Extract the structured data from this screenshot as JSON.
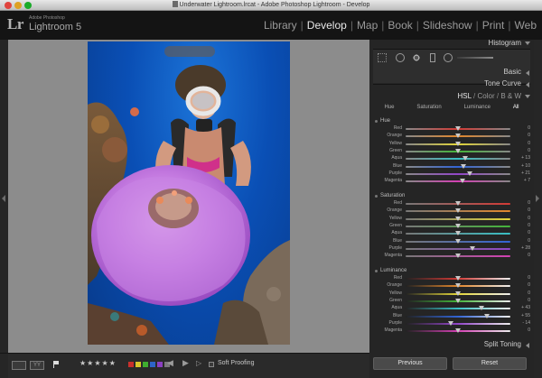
{
  "window": {
    "title": "Underwater Lightroom.lrcat - Adobe Photoshop Lightroom - Develop"
  },
  "identity": {
    "logo": "Lr",
    "brand": "Adobe Photoshop",
    "product": "Lightroom 5"
  },
  "modules": [
    {
      "label": "Library",
      "active": false
    },
    {
      "label": "Develop",
      "active": true
    },
    {
      "label": "Map",
      "active": false
    },
    {
      "label": "Book",
      "active": false
    },
    {
      "label": "Slideshow",
      "active": false
    },
    {
      "label": "Print",
      "active": false
    },
    {
      "label": "Web",
      "active": false
    }
  ],
  "panels": {
    "histogram": "Histogram",
    "basic": "Basic",
    "tone_curve": "Tone Curve",
    "hsl_title": "HSL",
    "hsl_sep1": "/",
    "color_title": "Color",
    "hsl_sep2": "/",
    "bw_title": "B & W",
    "split_toning": "Split Toning"
  },
  "hsl_tabs": [
    {
      "label": "Hue",
      "active": false
    },
    {
      "label": "Saturation",
      "active": false
    },
    {
      "label": "Luminance",
      "active": false
    },
    {
      "label": "All",
      "active": true
    }
  ],
  "sections": [
    {
      "title": "Hue",
      "sliders": [
        {
          "label": "Red",
          "value": "0",
          "pos": 0.5
        },
        {
          "label": "Orange",
          "value": "0",
          "pos": 0.5
        },
        {
          "label": "Yellow",
          "value": "0",
          "pos": 0.5
        },
        {
          "label": "Green",
          "value": "0",
          "pos": 0.5
        },
        {
          "label": "Aqua",
          "value": "+ 13",
          "pos": 0.57
        },
        {
          "label": "Blue",
          "value": "+ 10",
          "pos": 0.55
        },
        {
          "label": "Purple",
          "value": "+ 21",
          "pos": 0.61
        },
        {
          "label": "Magenta",
          "value": "+ 7",
          "pos": 0.54
        }
      ]
    },
    {
      "title": "Saturation",
      "sliders": [
        {
          "label": "Red",
          "value": "0",
          "pos": 0.5
        },
        {
          "label": "Orange",
          "value": "0",
          "pos": 0.5
        },
        {
          "label": "Yellow",
          "value": "0",
          "pos": 0.5
        },
        {
          "label": "Green",
          "value": "0",
          "pos": 0.5
        },
        {
          "label": "Aqua",
          "value": "0",
          "pos": 0.5
        },
        {
          "label": "Blue",
          "value": "0",
          "pos": 0.5
        },
        {
          "label": "Purple",
          "value": "+ 28",
          "pos": 0.64
        },
        {
          "label": "Magenta",
          "value": "0",
          "pos": 0.5
        }
      ]
    },
    {
      "title": "Luminance",
      "sliders": [
        {
          "label": "Red",
          "value": "0",
          "pos": 0.5
        },
        {
          "label": "Orange",
          "value": "0",
          "pos": 0.5
        },
        {
          "label": "Yellow",
          "value": "0",
          "pos": 0.5
        },
        {
          "label": "Green",
          "value": "0",
          "pos": 0.5
        },
        {
          "label": "Aqua",
          "value": "+ 43",
          "pos": 0.72
        },
        {
          "label": "Blue",
          "value": "+ 55",
          "pos": 0.78
        },
        {
          "label": "Purple",
          "value": "- 14",
          "pos": 0.43
        },
        {
          "label": "Magenta",
          "value": "0",
          "pos": 0.5
        }
      ]
    }
  ],
  "toolbar": {
    "view_grid_glyph": "YY",
    "stars": "★★★★★",
    "labels": [
      "#c8302c",
      "#d9c62a",
      "#3fae2f",
      "#2d64c8",
      "#8a3fc0",
      "#7a7a7a"
    ],
    "soft_proofing": "Soft Proofing"
  },
  "buttons": {
    "previous": "Previous",
    "reset": "Reset"
  },
  "colors": {
    "Red": "#d23a35",
    "Orange": "#e1862c",
    "Yellow": "#e2d53a",
    "Green": "#44b43a",
    "Aqua": "#38bfc4",
    "Blue": "#3264d4",
    "Purple": "#9146c8",
    "Magenta": "#d340b3"
  }
}
